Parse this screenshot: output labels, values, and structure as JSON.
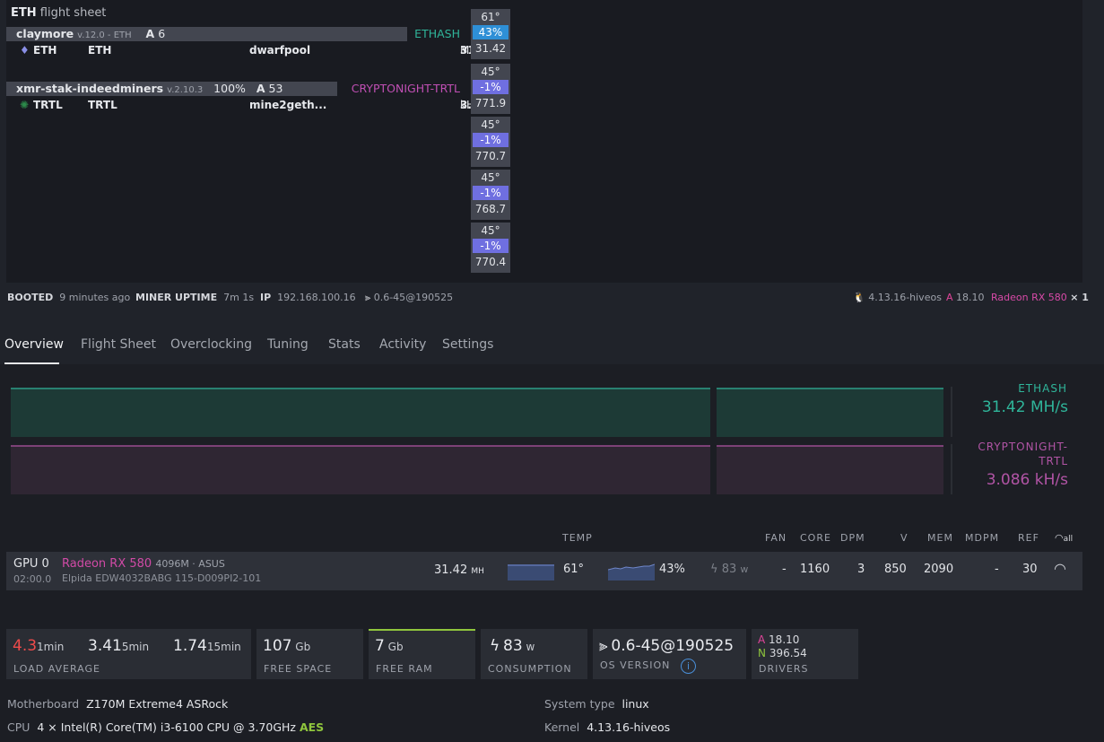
{
  "flight_sheet": {
    "coin_bold": "ETH",
    "title_rest": "flight sheet",
    "miners": [
      {
        "name": "claymore",
        "version": "v.12.0 - ETH",
        "extra": "",
        "accepted_prefix": "A",
        "accepted": "6",
        "algo": "ETHASH",
        "algo_color": "#2fb59a",
        "coin_icon": "ethereum-icon",
        "coin_glyph": "♦",
        "coin": "ETH",
        "wallet": "ETH",
        "pool": "dwarfpool",
        "hashrate": "31.42",
        "hash_unit": "MH"
      },
      {
        "name": "xmr-stak-indeedminers",
        "version": "v.2.10.3",
        "extra": "100%",
        "accepted_prefix": "A",
        "accepted": "53",
        "algo": "CRYPTONIGHT-TRTL",
        "algo_color": "#c04fb4",
        "coin_icon": "turtlecoin-icon",
        "coin_glyph": "✺",
        "coin": "TRTL",
        "wallet": "TRTL",
        "pool": "mine2geth...",
        "hashrate": "3.082",
        "hash_unit": "kH"
      }
    ]
  },
  "gpus": [
    {
      "temp": "61°",
      "fan": "43%",
      "hash": "31.42",
      "fan_color": "#2e8fd6"
    },
    {
      "temp": "45°",
      "fan": "-1%",
      "hash": "771.9",
      "fan_color": "#6f6fe0"
    },
    {
      "temp": "45°",
      "fan": "-1%",
      "hash": "770.7",
      "fan_color": "#6f6fe0"
    },
    {
      "temp": "45°",
      "fan": "-1%",
      "hash": "768.7",
      "fan_color": "#6f6fe0"
    },
    {
      "temp": "45°",
      "fan": "-1%",
      "hash": "770.4",
      "fan_color": "#6f6fe0"
    }
  ],
  "status": {
    "booted_label": "BOOTED",
    "booted_value": "9 minutes ago",
    "uptime_label": "MINER UPTIME",
    "uptime_value": "7m 1s",
    "ip_label": "IP",
    "ip_value": "192.168.100.16",
    "version": "0.6-45@190525",
    "kernel": "4.13.16-hiveos",
    "amd_prefix": "A",
    "amd_version": "18.10",
    "gpu_model": "Radeon RX 580",
    "gpu_count": "× 1"
  },
  "tabs": [
    "Overview",
    "Flight Sheet",
    "Overclocking",
    "Tuning",
    "Stats",
    "Activity",
    "Settings"
  ],
  "charts": [
    {
      "label": "ETHASH",
      "value": "31.42 MH/s",
      "color": "#2fb59a",
      "fill": "#1d3a36"
    },
    {
      "label_1": "CRYPTONIGHT-",
      "label_2": "TRTL",
      "value": "3.086 kH/s",
      "color": "#b154a5",
      "fill": "#2f2633"
    }
  ],
  "gpu_table": {
    "headers": {
      "temp": "TEMP",
      "fan": "FAN",
      "core": "CORE",
      "dpm": "DPM",
      "v": "V",
      "mem": "MEM",
      "mdpm": "MDPM",
      "ref": "REF",
      "all": "all"
    },
    "row": {
      "index": "GPU 0",
      "bus": "02:00.0",
      "model": "Radeon RX 580",
      "mem_info": "4096M · ASUS",
      "mem_detail": "Elpida EDW4032BABG 115-D009PI2-101",
      "hashrate": "31.42",
      "hash_unit": "MH",
      "temp": "61°",
      "fan": "43%",
      "power": "83",
      "power_unit": "w",
      "fan_val": "-",
      "core": "1160",
      "dpm": "3",
      "v": "850",
      "mem": "2090",
      "mdpm": "-",
      "ref": "30"
    }
  },
  "cards": {
    "load": {
      "l1": "4.3",
      "l1_unit": "1min",
      "l5": "3.41",
      "l5_unit": "5min",
      "l15": "1.74",
      "l15_unit": "15min",
      "label": "LOAD AVERAGE"
    },
    "disk": {
      "value": "107",
      "unit": "Gb",
      "label": "FREE SPACE"
    },
    "ram": {
      "value": "7",
      "unit": "Gb",
      "label": "FREE RAM"
    },
    "power": {
      "value": "83",
      "unit": "w",
      "label": "CONSUMPTION"
    },
    "os": {
      "value": "0.6-45@190525",
      "label": "OS VERSION"
    },
    "drivers": {
      "a_prefix": "A",
      "a_value": "18.10",
      "n_prefix": "N",
      "n_value": "396.54",
      "label": "DRIVERS"
    }
  },
  "system": {
    "motherboard_label": "Motherboard",
    "motherboard_value": "Z170M Extreme4 ASRock",
    "cpu_label": "CPU",
    "cpu_value": "4 × Intel(R) Core(TM) i3-6100 CPU @ 3.70GHz",
    "cpu_flag": "AES",
    "systype_label": "System type",
    "systype_value": "linux",
    "kernel_label": "Kernel",
    "kernel_value": "4.13.16-hiveos"
  }
}
